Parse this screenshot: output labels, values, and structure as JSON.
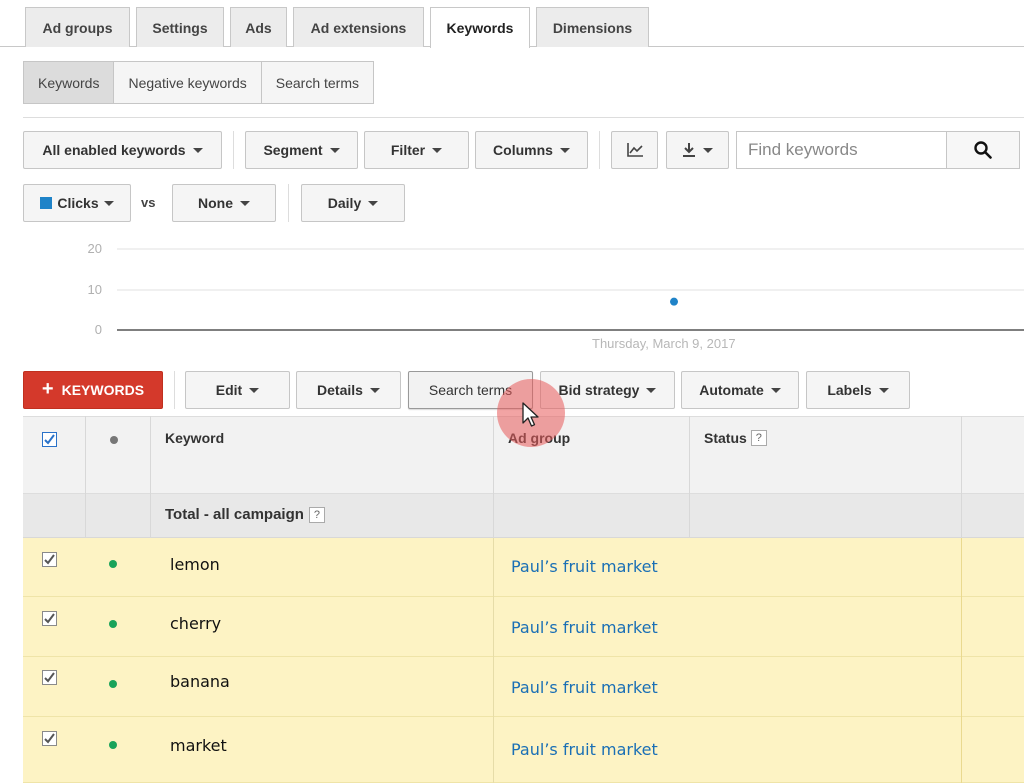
{
  "top_tabs": [
    {
      "label": "Ad groups"
    },
    {
      "label": "Settings"
    },
    {
      "label": "Ads"
    },
    {
      "label": "Ad extensions"
    },
    {
      "label": "Keywords"
    },
    {
      "label": "Dimensions"
    }
  ],
  "sub_tabs": [
    {
      "label": "Keywords"
    },
    {
      "label": "Negative keywords"
    },
    {
      "label": "Search terms"
    }
  ],
  "toolbar": {
    "filter_view": "All enabled keywords",
    "segment": "Segment",
    "filter": "Filter",
    "columns": "Columns",
    "chart_icon": "line-chart-icon",
    "download_icon": "download-icon",
    "search_placeholder": "Find keywords",
    "search_icon": "search-icon"
  },
  "chart_controls": {
    "metric1": "Clicks",
    "metric1_color": "#1f83c8",
    "vs": "vs",
    "metric2": "None",
    "period": "Daily"
  },
  "chart_data": {
    "type": "scatter",
    "y_ticks": [
      "20",
      "10",
      "0"
    ],
    "ylim": [
      0,
      20
    ],
    "x_label": "Thursday, March 9, 2017",
    "points": [
      {
        "x": "Thursday, March 9, 2017",
        "y": 7
      }
    ],
    "color": "#1f83c8"
  },
  "actions": {
    "add_keywords": "KEYWORDS",
    "edit": "Edit",
    "details": "Details",
    "search_terms": "Search terms",
    "bid_strategy": "Bid strategy",
    "automate": "Automate",
    "labels": "Labels"
  },
  "table": {
    "headers": {
      "keyword": "Keyword",
      "ad_group": "Ad group",
      "status": "Status",
      "help": "?"
    },
    "total_label": "Total - all campaign",
    "rows": [
      {
        "keyword": "lemon",
        "ad_group": "Paul’s fruit market"
      },
      {
        "keyword": "cherry",
        "ad_group": "Paul’s fruit market"
      },
      {
        "keyword": "banana",
        "ad_group": "Paul’s fruit market"
      },
      {
        "keyword": "market",
        "ad_group": "Paul’s fruit market"
      }
    ],
    "status_dot_color": "#1aa35a"
  }
}
